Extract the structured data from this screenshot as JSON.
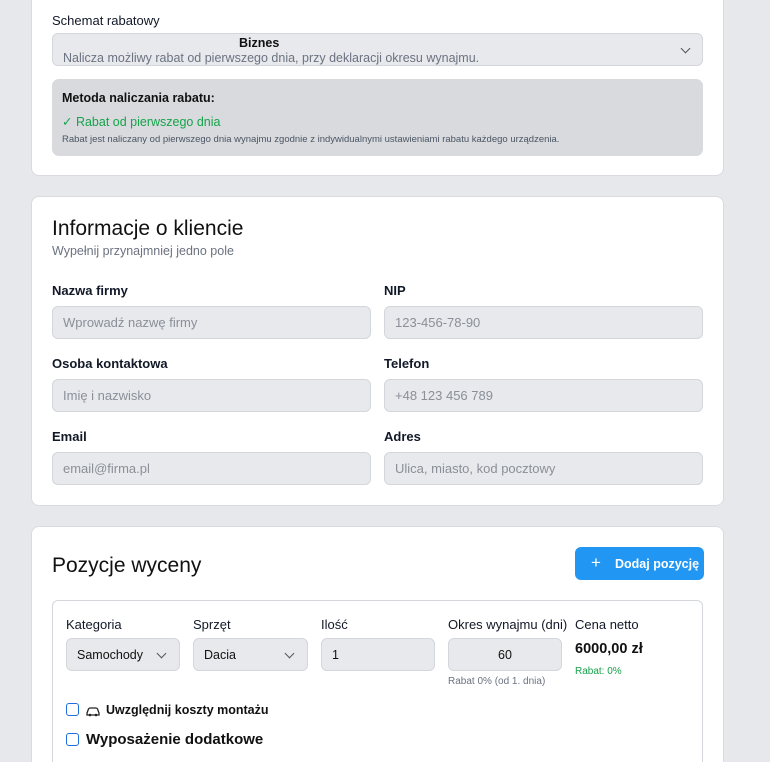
{
  "discount": {
    "label": "Schemat rabatowy",
    "select_value": "Biznes",
    "select_description": "Nalicza możliwy rabat od pierwszego dnia, przy deklaracji okresu wynajmu.",
    "method_title": "Metoda naliczania rabatu:",
    "method_value": "✓ Rabat od pierwszego dnia",
    "method_description": "Rabat jest naliczany od pierwszego dnia wynajmu zgodnie z indywidualnymi ustawieniami rabatu każdego urządzenia.",
    "accent_green": "#16a34a"
  },
  "client": {
    "title": "Informacje o kliencie",
    "subtitle": "Wypełnij przynajmniej jedno pole",
    "fields": {
      "company": {
        "label": "Nazwa firmy",
        "placeholder": "Wprowadź nazwę firmy"
      },
      "nip": {
        "label": "NIP",
        "placeholder": "123-456-78-90"
      },
      "contact": {
        "label": "Osoba kontaktowa",
        "placeholder": "Imię i nazwisko"
      },
      "phone": {
        "label": "Telefon",
        "placeholder": "+48 123 456 789"
      },
      "email": {
        "label": "Email",
        "placeholder": "email@firma.pl"
      },
      "address": {
        "label": "Adres",
        "placeholder": "Ulica, miasto, kod pocztowy"
      }
    }
  },
  "items": {
    "title": "Pozycje wyceny",
    "add_button_label": "Dodaj pozycję",
    "add_button_icon": "plus-icon",
    "accent_blue": "#2196f3",
    "row": {
      "category_label": "Kategoria",
      "category_value": "Samochody",
      "equipment_label": "Sprzęt",
      "equipment_value": "Dacia",
      "quantity_label": "Ilość",
      "quantity_value": "1",
      "period_label": "Okres wynajmu (dni)",
      "period_value": "60",
      "period_note": "Rabat 0% (od 1. dnia)",
      "price_label": "Cena netto",
      "price_value": "6000,00 zł",
      "price_discount": "Rabat: 0%",
      "mounting_label": "Uwzględnij koszty montażu",
      "mounting_icon": "car-icon",
      "extras_label": "Wyposażenie dodatkowe"
    }
  }
}
